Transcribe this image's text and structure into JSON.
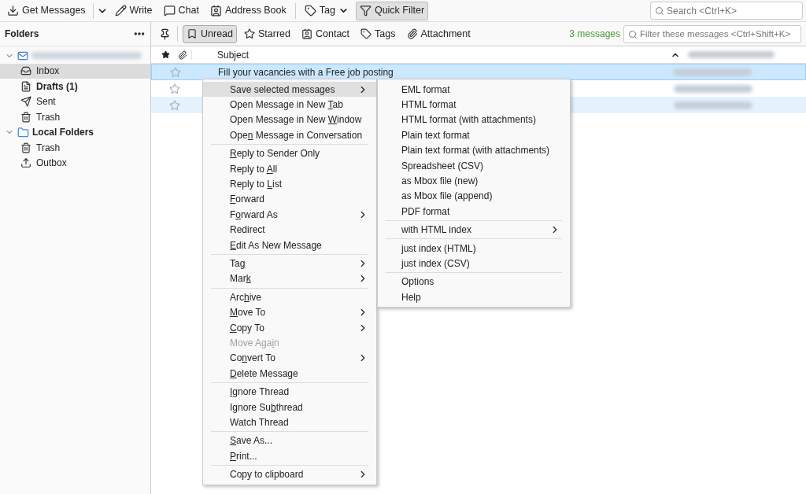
{
  "toolbar": {
    "buttons": [
      {
        "label": "Get Messages",
        "dropdown": true,
        "pressed": false
      },
      {
        "label": "Write",
        "dropdown": false,
        "pressed": false
      },
      {
        "label": "Chat",
        "dropdown": false,
        "pressed": false
      },
      {
        "label": "Address Book",
        "dropdown": false,
        "pressed": false
      },
      {
        "label": "Tag",
        "dropdown": true,
        "pressed": false
      },
      {
        "label": "Quick Filter",
        "dropdown": false,
        "pressed": true
      }
    ],
    "search": {
      "placeholder": "Search <Ctrl+K>"
    }
  },
  "sidebar": {
    "title": "Folders",
    "items": [
      {
        "kind": "account",
        "expanded": true,
        "children": [
          {
            "label": "Inbox",
            "kind": "inbox",
            "bold": false,
            "selected": true
          },
          {
            "label": "Drafts (1)",
            "kind": "drafts",
            "bold": true,
            "selected": false
          },
          {
            "label": "Sent",
            "kind": "sent",
            "bold": false,
            "selected": false
          },
          {
            "label": "Trash",
            "kind": "trash",
            "bold": false,
            "selected": false
          }
        ]
      },
      {
        "label": "Local Folders",
        "kind": "folder",
        "expanded": true,
        "children": [
          {
            "label": "Trash",
            "kind": "trash",
            "bold": false,
            "selected": false
          },
          {
            "label": "Outbox",
            "kind": "outbox",
            "bold": false,
            "selected": false
          }
        ]
      }
    ]
  },
  "quick_filter": {
    "buttons": [
      {
        "label": "Unread",
        "pressed": true
      },
      {
        "label": "Starred",
        "pressed": false
      },
      {
        "label": "Contact",
        "pressed": false
      },
      {
        "label": "Tags",
        "pressed": false
      },
      {
        "label": "Attachment",
        "pressed": false
      }
    ],
    "count": "3 messages",
    "placeholder": "Filter these messages <Ctrl+Shift+K>"
  },
  "table": {
    "columns": [
      "Subject"
    ],
    "rows": [
      {
        "subject": "Fill your vacancies with a Free job posting",
        "selected": true,
        "starred": false
      },
      {
        "selected": false,
        "starred": false
      },
      {
        "selected": true,
        "starred": false
      }
    ]
  },
  "context_menu": {
    "groups": [
      [
        {
          "pre": "Save selected messages",
          "submenu": true,
          "highlighted": true,
          "disabled": false
        },
        {
          "pre": "Open Message in New ",
          "key": "T",
          "post": "ab",
          "submenu": false,
          "highlighted": false,
          "disabled": false
        },
        {
          "pre": "Open Message in New ",
          "key": "W",
          "post": "indow",
          "submenu": false,
          "highlighted": false,
          "disabled": false
        },
        {
          "pre": "Ope",
          "key": "n",
          "post": " Message in Conversation",
          "submenu": false,
          "highlighted": false,
          "disabled": false
        }
      ],
      [
        {
          "key": "R",
          "post": "eply to Sender Only",
          "submenu": false,
          "highlighted": false,
          "disabled": false
        },
        {
          "pre": "Reply to ",
          "key": "A",
          "post": "ll",
          "submenu": false,
          "highlighted": false,
          "disabled": false
        },
        {
          "pre": "Reply to ",
          "key": "L",
          "post": "ist",
          "submenu": false,
          "highlighted": false,
          "disabled": false
        },
        {
          "key": "F",
          "post": "orward",
          "submenu": false,
          "highlighted": false,
          "disabled": false
        },
        {
          "pre": "F",
          "key": "o",
          "post": "rward As",
          "submenu": true,
          "highlighted": false,
          "disabled": false
        },
        {
          "pre": "Redirect",
          "submenu": false,
          "highlighted": false,
          "disabled": false
        },
        {
          "key": "E",
          "post": "dit As New Message",
          "submenu": false,
          "highlighted": false,
          "disabled": false
        }
      ],
      [
        {
          "pre": "Ta",
          "key": "g",
          "submenu": true,
          "highlighted": false,
          "disabled": false
        },
        {
          "pre": "Mar",
          "key": "k",
          "submenu": true,
          "highlighted": false,
          "disabled": false
        }
      ],
      [
        {
          "pre": "Arc",
          "key": "h",
          "post": "ive",
          "submenu": false,
          "highlighted": false,
          "disabled": false
        },
        {
          "key": "M",
          "post": "ove To",
          "submenu": true,
          "highlighted": false,
          "disabled": false
        },
        {
          "key": "C",
          "post": "opy To",
          "submenu": true,
          "highlighted": false,
          "disabled": false
        },
        {
          "pre": "Move Aga",
          "key": "i",
          "post": "n",
          "submenu": false,
          "highlighted": false,
          "disabled": true
        },
        {
          "pre": "Co",
          "key": "n",
          "post": "vert To",
          "submenu": true,
          "highlighted": false,
          "disabled": false
        },
        {
          "key": "D",
          "post": "elete Message",
          "submenu": false,
          "highlighted": false,
          "disabled": false
        }
      ],
      [
        {
          "key": "I",
          "post": "gnore Thread",
          "submenu": false,
          "highlighted": false,
          "disabled": false
        },
        {
          "pre": "Ignore Su",
          "key": "b",
          "post": "thread",
          "submenu": false,
          "highlighted": false,
          "disabled": false
        },
        {
          "pre": "Watch Thread",
          "submenu": false,
          "highlighted": false,
          "disabled": false
        }
      ],
      [
        {
          "key": "S",
          "post": "ave As...",
          "submenu": false,
          "highlighted": false,
          "disabled": false
        },
        {
          "key": "P",
          "post": "rint...",
          "submenu": false,
          "highlighted": false,
          "disabled": false
        }
      ],
      [
        {
          "pre": "Copy to clipboard",
          "submenu": true,
          "highlighted": false,
          "disabled": false
        }
      ]
    ]
  },
  "submenu": {
    "groups": [
      [
        {
          "label": "EML format",
          "submenu": false
        },
        {
          "label": "HTML format",
          "submenu": false
        },
        {
          "label": "HTML format (with attachments)",
          "submenu": false
        },
        {
          "label": "Plain text format",
          "submenu": false
        },
        {
          "label": "Plain text format (with attachments)",
          "submenu": false
        },
        {
          "label": "Spreadsheet (CSV)",
          "submenu": false
        },
        {
          "label": "as Mbox file (new)",
          "submenu": false
        },
        {
          "label": "as Mbox file (append)",
          "submenu": false
        },
        {
          "label": "PDF format",
          "submenu": false
        }
      ],
      [
        {
          "label": "with HTML index",
          "submenu": true
        }
      ],
      [
        {
          "label": "just index (HTML)",
          "submenu": false
        },
        {
          "label": "just index (CSV)",
          "submenu": false
        }
      ],
      [
        {
          "label": "Options",
          "submenu": false
        },
        {
          "label": "Help",
          "submenu": false
        }
      ]
    ]
  }
}
